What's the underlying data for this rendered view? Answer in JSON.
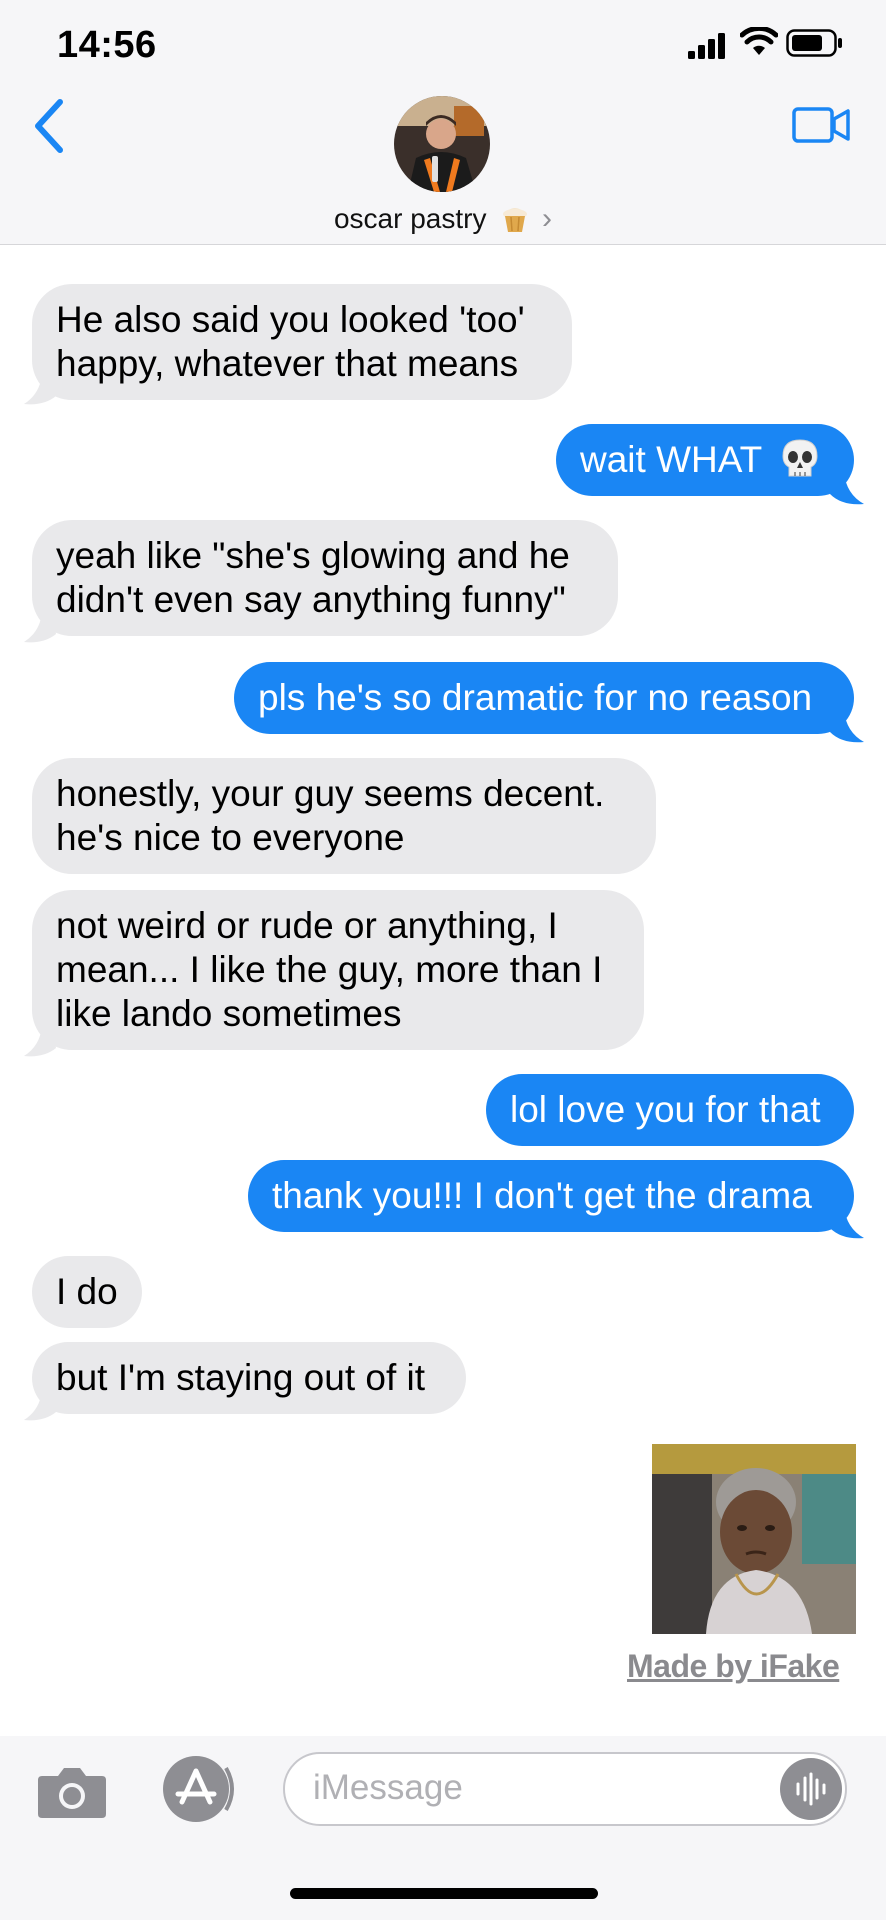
{
  "status_bar": {
    "time": "14:56"
  },
  "header": {
    "contact_name": "oscar pastry",
    "contact_emoji": "cupcake"
  },
  "messages": [
    {
      "direction": "incoming",
      "text_lines": [
        "He also said you looked 'too'",
        "happy, whatever that means"
      ]
    },
    {
      "direction": "outgoing",
      "text": "wait WHAT",
      "emoji": "skull"
    },
    {
      "direction": "incoming",
      "text_lines": [
        "yeah like \"she's glowing and he",
        "didn't even say anything funny\""
      ]
    },
    {
      "direction": "outgoing",
      "text": "pls he's so dramatic for no reason"
    },
    {
      "direction": "incoming",
      "text_lines": [
        "honestly, your guy seems decent.",
        "he's nice to everyone"
      ]
    },
    {
      "direction": "incoming",
      "text_lines": [
        "not weird or rude or anything, I",
        "mean... I like the guy, more than I",
        "like lando sometimes"
      ]
    },
    {
      "direction": "outgoing",
      "text": "lol love you for that"
    },
    {
      "direction": "outgoing",
      "text": "thank you!!! I don't get the drama"
    },
    {
      "direction": "incoming",
      "text": "I do"
    },
    {
      "direction": "incoming",
      "text": "but I'm staying out of it"
    }
  ],
  "attachment": {
    "type": "gif-image"
  },
  "watermark": "Made by iFake",
  "input_bar": {
    "placeholder": "iMessage"
  },
  "colors": {
    "accent": "#1a86f4",
    "incoming_bubble": "#e9e9eb",
    "header_bg": "#f6f6f8"
  }
}
